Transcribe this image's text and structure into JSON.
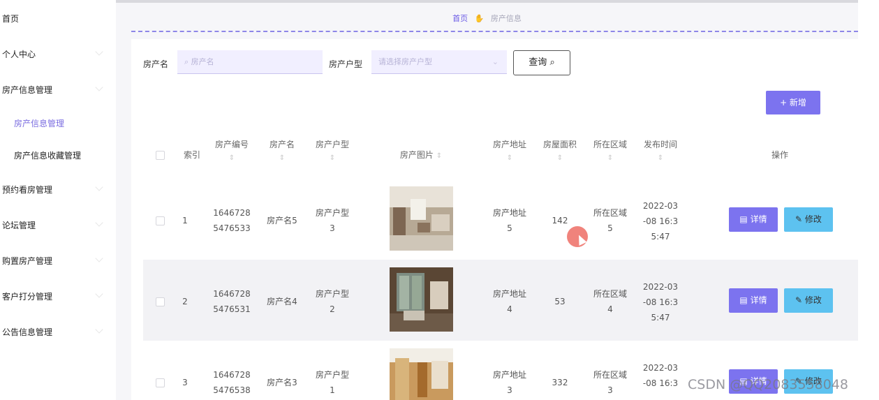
{
  "sidebar": {
    "items": [
      {
        "label": "首页"
      },
      {
        "label": "个人中心"
      },
      {
        "label": "房产信息管理"
      },
      {
        "label": "房产信息管理"
      },
      {
        "label": "房产信息收藏管理"
      },
      {
        "label": "预约看房管理"
      },
      {
        "label": "论坛管理"
      },
      {
        "label": "购置房产管理"
      },
      {
        "label": "客户打分管理"
      },
      {
        "label": "公告信息管理"
      }
    ]
  },
  "breadcrumb": {
    "home": "首页",
    "current": "房产信息"
  },
  "search": {
    "name_label": "房产名",
    "name_placeholder": "房产名",
    "type_label": "房产户型",
    "type_placeholder": "请选择房产户型",
    "query_label": "查询"
  },
  "toolbar": {
    "add_label": "+ 新增"
  },
  "table": {
    "headers": {
      "index": "索引",
      "code": "房产编号",
      "name": "房产名",
      "type": "房产户型",
      "image": "房产图片",
      "address": "房产地址",
      "area": "房屋面积",
      "region": "所在区域",
      "time": "发布时间",
      "actions": "操作"
    },
    "rows": [
      {
        "index": "1",
        "code1": "1646728",
        "code2": "5476533",
        "name": "房产名5",
        "type1": "房产户型",
        "type2": "3",
        "addr1": "房产地址",
        "addr2": "5",
        "area": "142",
        "reg1": "所在区域",
        "reg2": "5",
        "t1": "2022-03",
        "t2": "-08 16:3",
        "t3": "5:47"
      },
      {
        "index": "2",
        "code1": "1646728",
        "code2": "5476531",
        "name": "房产名4",
        "type1": "房产户型",
        "type2": "2",
        "addr1": "房产地址",
        "addr2": "4",
        "area": "53",
        "reg1": "所在区域",
        "reg2": "4",
        "t1": "2022-03",
        "t2": "-08 16:3",
        "t3": "5:47"
      },
      {
        "index": "3",
        "code1": "1646728",
        "code2": "5476538",
        "name": "房产名3",
        "type1": "房产户型",
        "type2": "1",
        "addr1": "房产地址",
        "addr2": "3",
        "area": "332",
        "reg1": "所在区域",
        "reg2": "3",
        "t1": "2022-03",
        "t2": "-08 16:3",
        "t3": ""
      }
    ],
    "detail_label": "详情",
    "edit_label": "修改"
  },
  "watermark": "CSDN @QQ2083558048",
  "colors": {
    "accent": "#7c73ef",
    "edit": "#5dc2f0"
  }
}
